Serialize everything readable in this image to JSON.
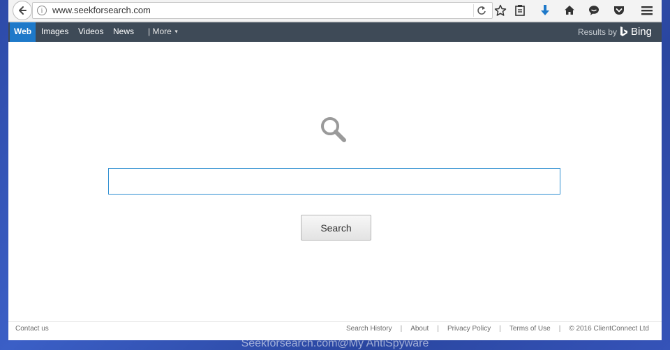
{
  "browser": {
    "url": "www.seekforsearch.com",
    "icons": {
      "back": "back-arrow-icon",
      "info": "info-icon",
      "reload": "reload-icon",
      "bookmark": "star-icon",
      "reading_list": "clipboard-icon",
      "downloads": "download-arrow-icon",
      "home": "home-icon",
      "chat": "chat-bubble-icon",
      "pocket": "pocket-icon",
      "menu": "hamburger-menu-icon"
    },
    "download_color": "#1e79c9"
  },
  "nav": {
    "tabs": [
      {
        "label": "Web",
        "active": true
      },
      {
        "label": "Images",
        "active": false
      },
      {
        "label": "Videos",
        "active": false
      },
      {
        "label": "News",
        "active": false
      }
    ],
    "more_label": "| More",
    "results_by_label": "Results by",
    "bing_label": "Bing",
    "bar_color": "#3e4a57",
    "active_color": "#1e79c9"
  },
  "main": {
    "search_value": "",
    "search_button_label": "Search"
  },
  "footer": {
    "contact_label": "Contact us",
    "links": [
      "Search History",
      "About",
      "Privacy Policy",
      "Terms of Use"
    ],
    "copyright": "© 2016 ClientConnect Ltd"
  },
  "watermark": "Seekforsearch.com@My AntiSpyware"
}
